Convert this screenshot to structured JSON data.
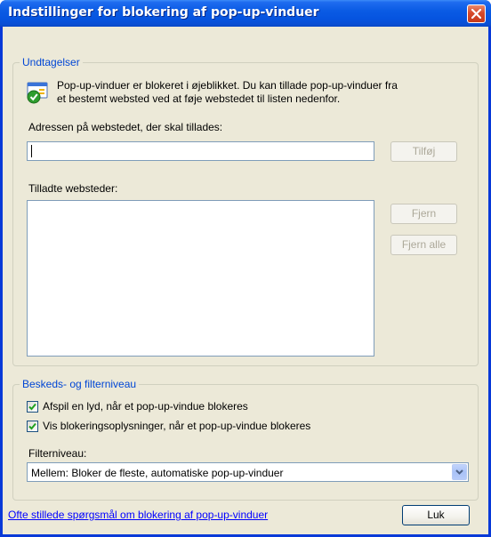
{
  "window": {
    "title": "Indstillinger for blokering af pop-up-vinduer"
  },
  "exceptions": {
    "legend": "Undtagelser",
    "info_line1": "Pop-up-vinduer er blokeret i øjeblikket. Du kan tillade pop-up-vinduer fra",
    "info_line2": "et bestemt websted ved at føje webstedet til listen nedenfor.",
    "address_label": "Adressen på webstedet, der skal tillades:",
    "address_value": "",
    "add_button": "Tilføj",
    "allowed_label": "Tilladte websteder:",
    "allowed_sites": [],
    "remove_button": "Fjern",
    "remove_all_button": "Fjern alle"
  },
  "notifications": {
    "legend": "Beskeds- og filterniveau",
    "play_sound_label": "Afspil en lyd, når et pop-up-vindue blokeres",
    "play_sound_checked": true,
    "show_info_label": "Vis blokeringsoplysninger, når et pop-up-vindue blokeres",
    "show_info_checked": true,
    "filter_label": "Filterniveau:",
    "filter_value": "Mellem: Bloker de fleste, automatiske pop-up-vinduer"
  },
  "footer": {
    "faq_link": "Ofte stillede spørgsmål om blokering af pop-up-vinduer",
    "close_button": "Luk"
  },
  "colors": {
    "titlebar": "#0a5be4",
    "dialog_bg": "#ece9d8",
    "legend_text": "#0046d5",
    "link": "#0000ff"
  }
}
